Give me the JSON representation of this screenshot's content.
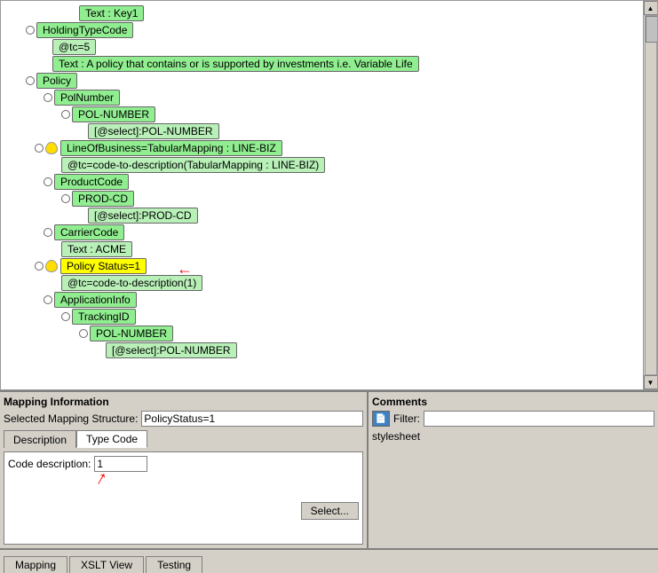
{
  "tree": {
    "nodes": [
      {
        "id": "textKey1",
        "label": "Text : Key1",
        "type": "node-box green-bg",
        "indent": 1,
        "hasCircle": false
      },
      {
        "id": "holdingTypeCode",
        "label": "HoldingTypeCode",
        "type": "node-box green-bg",
        "indent": 0,
        "hasCircle": true
      },
      {
        "id": "atTc5",
        "label": "@tc=5",
        "type": "node-box light-green",
        "indent": 2,
        "hasCircle": false
      },
      {
        "id": "textPolicy",
        "label": "Text : A policy that contains or is supported by investments i.e. Variable Life",
        "type": "node-box green-bg",
        "indent": 2,
        "hasCircle": false
      },
      {
        "id": "policy",
        "label": "Policy",
        "type": "node-box green-bg",
        "indent": 0,
        "hasCircle": true
      },
      {
        "id": "polNumber",
        "label": "PolNumber",
        "type": "node-box green-bg",
        "indent": 1,
        "hasCircle": true
      },
      {
        "id": "polNumberVal",
        "label": "POL-NUMBER",
        "type": "node-box green-bg",
        "indent": 2,
        "hasCircle": true
      },
      {
        "id": "selectPolNumber",
        "label": "[@select]:POL-NUMBER",
        "type": "node-box light-green",
        "indent": 3,
        "hasCircle": false
      },
      {
        "id": "lineOfBusiness",
        "label": "LineOfBusiness=TabularMapping : LINE-BIZ",
        "type": "node-box green-bg",
        "indent": 1,
        "hasCircle": true,
        "hasBulb": true
      },
      {
        "id": "atTcCode",
        "label": "@tc=code-to-description(TabularMapping : LINE-BIZ)",
        "type": "node-box light-green",
        "indent": 2,
        "hasCircle": false
      },
      {
        "id": "productCode",
        "label": "ProductCode",
        "type": "node-box green-bg",
        "indent": 1,
        "hasCircle": true
      },
      {
        "id": "prodCd",
        "label": "PROD-CD",
        "type": "node-box green-bg",
        "indent": 2,
        "hasCircle": true
      },
      {
        "id": "selectProdCd",
        "label": "[@select]:PROD-CD",
        "type": "node-box light-green",
        "indent": 3,
        "hasCircle": false
      },
      {
        "id": "carrierCode",
        "label": "CarrierCode",
        "type": "node-box green-bg",
        "indent": 1,
        "hasCircle": true
      },
      {
        "id": "textAcme",
        "label": "Text : ACME",
        "type": "node-box light-green",
        "indent": 2,
        "hasCircle": false
      },
      {
        "id": "policyStatus",
        "label": "Policy Status=1",
        "type": "node-box highlight",
        "indent": 1,
        "hasCircle": true,
        "hasBulb": true
      },
      {
        "id": "atTcCode1",
        "label": "@tc=code-to-description(1)",
        "type": "node-box light-green",
        "indent": 2,
        "hasCircle": false
      },
      {
        "id": "applicationInfo",
        "label": "ApplicationInfo",
        "type": "node-box green-bg",
        "indent": 1,
        "hasCircle": true
      },
      {
        "id": "trackingId",
        "label": "TrackingID",
        "type": "node-box green-bg",
        "indent": 2,
        "hasCircle": true
      },
      {
        "id": "polNumberVal2",
        "label": "POL-NUMBER",
        "type": "node-box green-bg",
        "indent": 3,
        "hasCircle": true
      },
      {
        "id": "selectPolNumber2",
        "label": "[@select]:POL-NUMBER",
        "type": "node-box light-green",
        "indent": 4,
        "hasCircle": false
      }
    ]
  },
  "mappingPanel": {
    "title": "Mapping Information",
    "selectedLabel": "Selected Mapping Structure:",
    "selectedValue": "PolicyStatus=1",
    "tabs": [
      {
        "id": "description",
        "label": "Description",
        "active": false
      },
      {
        "id": "typeCode",
        "label": "Type Code",
        "active": true
      }
    ],
    "codeDescLabel": "Code description:",
    "codeDescValue": "1",
    "selectBtn": "Select..."
  },
  "commentsPanel": {
    "title": "Comments",
    "filterLabel": "Filter:",
    "filterValue": "",
    "stylesheetText": "stylesheet"
  },
  "bottomTabs": [
    {
      "id": "mapping",
      "label": "Mapping",
      "active": false
    },
    {
      "id": "xsltView",
      "label": "XSLT View",
      "active": false
    },
    {
      "id": "testing",
      "label": "Testing",
      "active": false
    }
  ]
}
